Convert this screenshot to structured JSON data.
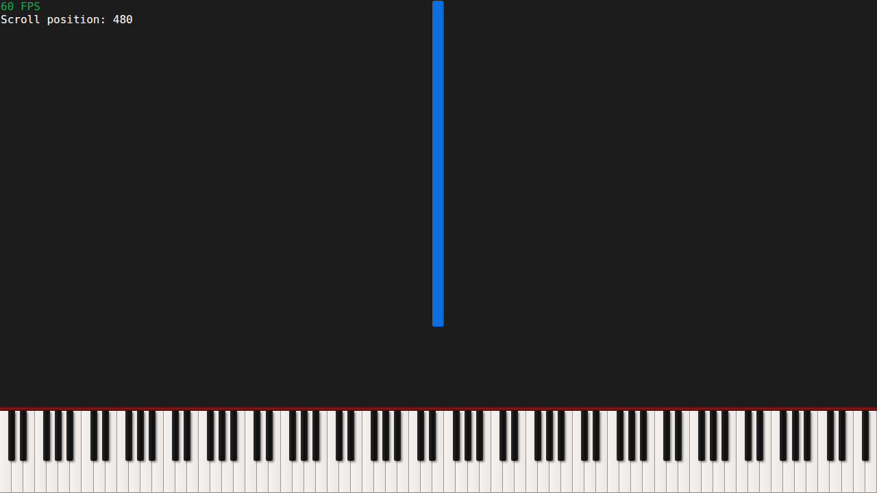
{
  "hud": {
    "fps": "60 FPS",
    "scroll": "Scroll position: 480"
  },
  "keyboard": {
    "first_note": 0,
    "last_note": 127,
    "pressed_notes": []
  },
  "notes": [
    {
      "pitch": 64,
      "start": 117,
      "length": 476,
      "color": "#0a6fe0"
    }
  ]
}
